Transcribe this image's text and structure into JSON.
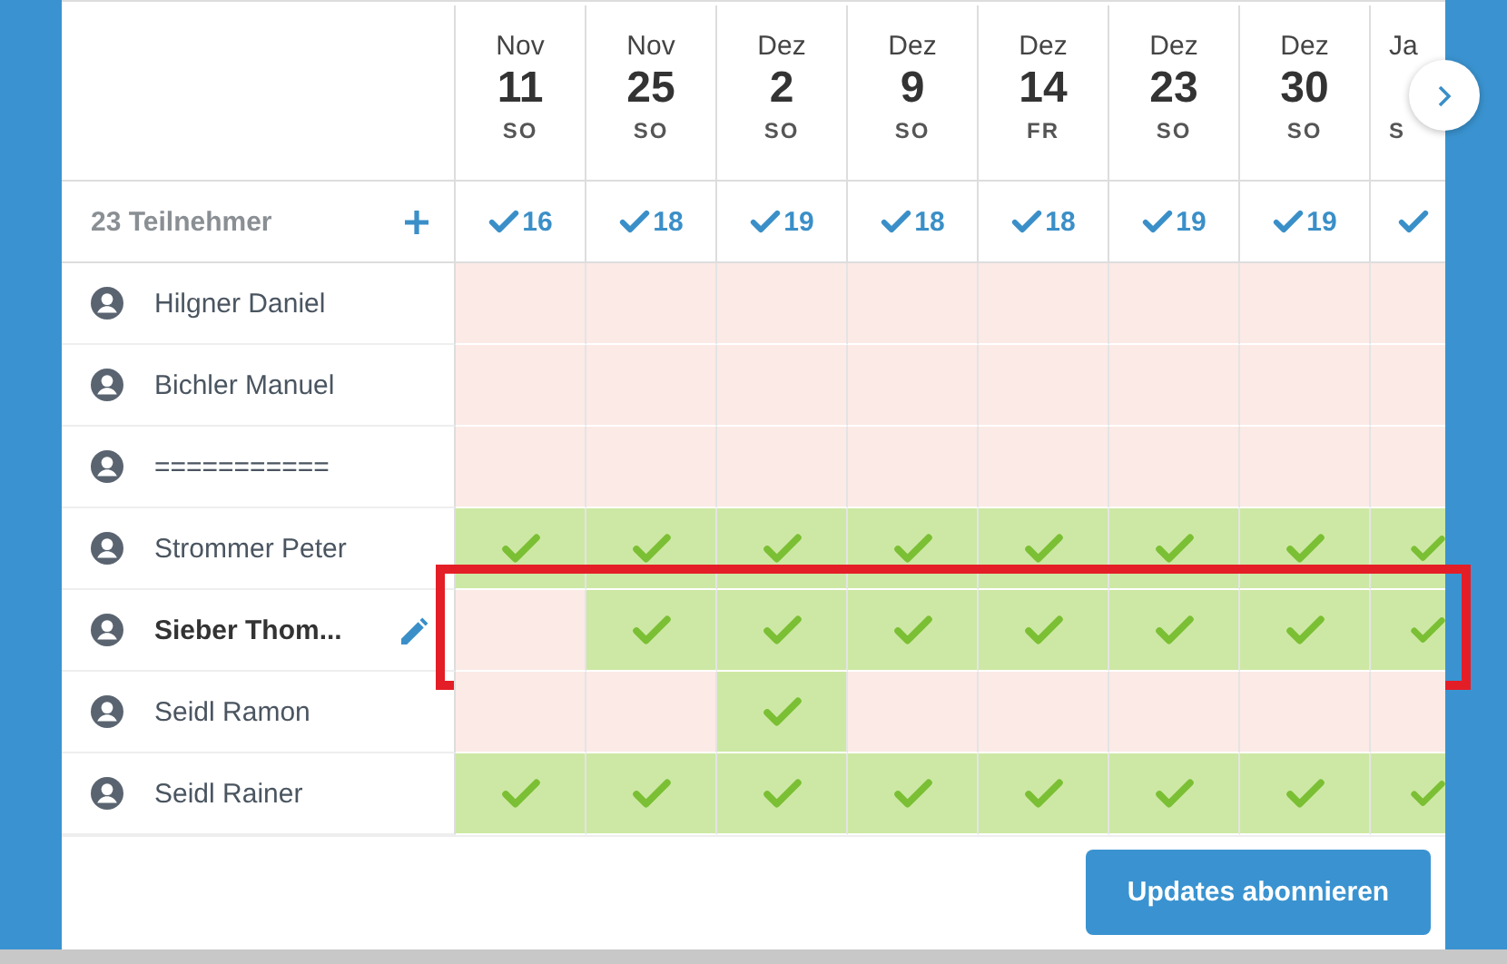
{
  "dates": [
    {
      "month": "Nov",
      "day": "11",
      "weekday": "SO",
      "count": "16"
    },
    {
      "month": "Nov",
      "day": "25",
      "weekday": "SO",
      "count": "18"
    },
    {
      "month": "Dez",
      "day": "2",
      "weekday": "SO",
      "count": "19"
    },
    {
      "month": "Dez",
      "day": "9",
      "weekday": "SO",
      "count": "18"
    },
    {
      "month": "Dez",
      "day": "14",
      "weekday": "FR",
      "count": "18"
    },
    {
      "month": "Dez",
      "day": "23",
      "weekday": "SO",
      "count": "19"
    },
    {
      "month": "Dez",
      "day": "30",
      "weekday": "SO",
      "count": "19"
    },
    {
      "month": "Ja",
      "weekday": "S"
    }
  ],
  "participants_label": "23 Teilnehmer",
  "participants": [
    {
      "name": "Hilgner Daniel",
      "is_self": false,
      "highlighted": false,
      "votes": [
        false,
        false,
        false,
        false,
        false,
        false,
        false,
        false
      ]
    },
    {
      "name": "Bichler Manuel",
      "is_self": false,
      "highlighted": false,
      "votes": [
        false,
        false,
        false,
        false,
        false,
        false,
        false,
        false
      ]
    },
    {
      "name": "===========",
      "is_self": false,
      "highlighted": false,
      "votes": [
        false,
        false,
        false,
        false,
        false,
        false,
        false,
        false
      ]
    },
    {
      "name": "Strommer Peter",
      "is_self": false,
      "highlighted": false,
      "votes": [
        true,
        true,
        true,
        true,
        true,
        true,
        true,
        true
      ]
    },
    {
      "name": "Sieber Thom...",
      "is_self": true,
      "highlighted": true,
      "votes": [
        false,
        true,
        true,
        true,
        true,
        true,
        true,
        true
      ]
    },
    {
      "name": "Seidl Ramon",
      "is_self": false,
      "highlighted": false,
      "votes": [
        false,
        false,
        true,
        false,
        false,
        false,
        false,
        false
      ]
    },
    {
      "name": "Seidl Rainer",
      "is_self": false,
      "highlighted": false,
      "votes": [
        true,
        true,
        true,
        true,
        true,
        true,
        true,
        true
      ]
    }
  ],
  "subscribe_button": "Updates abonnieren"
}
